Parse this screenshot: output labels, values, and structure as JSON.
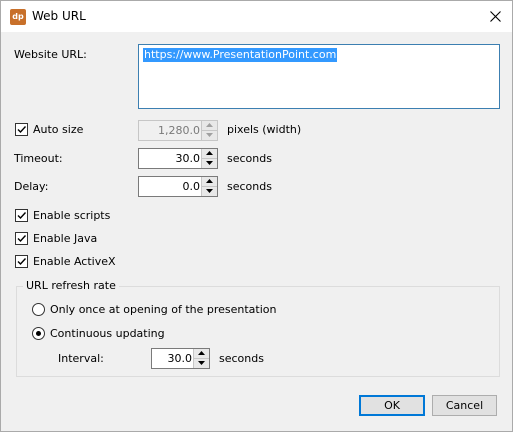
{
  "window": {
    "title": "Web URL",
    "app_icon_text": "dp",
    "icon": "dp-app-icon"
  },
  "close_icon": "close-icon",
  "url": {
    "label": "Website URL:",
    "value": "https://www.PresentationPoint.com"
  },
  "auto_size": {
    "label": "Auto size",
    "checked": true,
    "value": "1,280.0",
    "unit": "pixels (width)"
  },
  "timeout": {
    "label": "Timeout:",
    "value": "30.0",
    "unit": "seconds"
  },
  "delay": {
    "label": "Delay:",
    "value": "0.0",
    "unit": "seconds"
  },
  "options": {
    "enable_scripts": {
      "label": "Enable scripts",
      "checked": true
    },
    "enable_java": {
      "label": "Enable Java",
      "checked": true
    },
    "enable_activex": {
      "label": "Enable ActiveX",
      "checked": true
    }
  },
  "refresh": {
    "title": "URL refresh rate",
    "once_label": "Only once at opening of the presentation",
    "continuous_label": "Continuous updating",
    "selected": "continuous",
    "interval_label": "Interval:",
    "interval_value": "30.0",
    "interval_unit": "seconds"
  },
  "buttons": {
    "ok": "OK",
    "cancel": "Cancel"
  },
  "colors": {
    "accent": "#0078d7",
    "selection": "#3399ff",
    "app_icon": "#c8702a"
  }
}
